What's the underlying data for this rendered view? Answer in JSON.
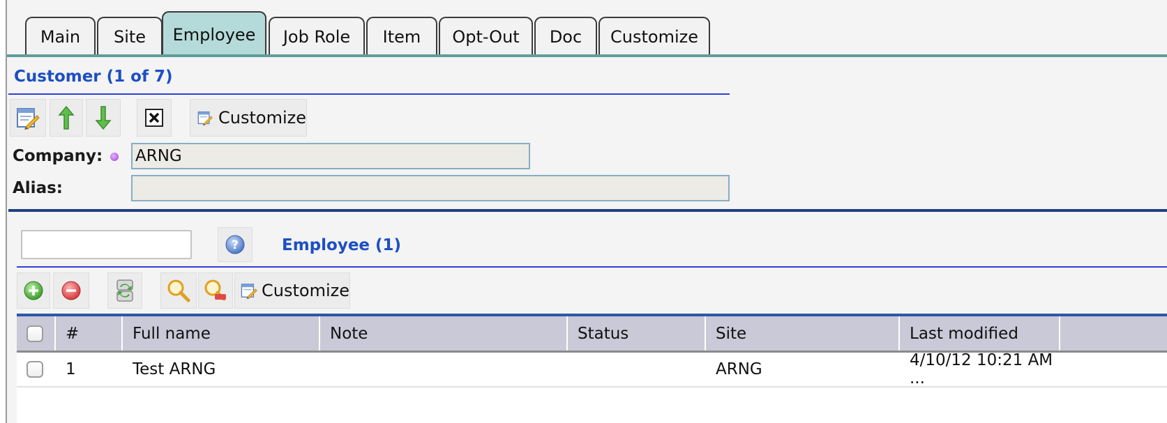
{
  "tabs": [
    {
      "label": "Main"
    },
    {
      "label": "Site"
    },
    {
      "label": "Employee"
    },
    {
      "label": "Job Role"
    },
    {
      "label": "Item"
    },
    {
      "label": "Opt-Out"
    },
    {
      "label": "Doc"
    },
    {
      "label": "Customize"
    }
  ],
  "active_tab": "Employee",
  "customer": {
    "title": "Customer (1 of 7)",
    "toolbar": {
      "icons": [
        "edit-icon",
        "arrow-up-icon",
        "arrow-down-icon",
        "close-box-icon",
        "customize-icon"
      ],
      "customize_label": "Customize"
    },
    "company_label": "Company:",
    "company_value": "ARNG",
    "alias_label": "Alias:",
    "alias_value": ""
  },
  "employee": {
    "search_value": "",
    "title": "Employee (1)",
    "toolbar": {
      "icons": [
        "add-icon",
        "remove-icon",
        "refresh-icon",
        "search-icon",
        "clear-search-icon",
        "customize-icon"
      ],
      "customize_label": "Customize"
    },
    "columns": [
      "#",
      "Full name",
      "Note",
      "Status",
      "Site",
      "Last modified"
    ],
    "rows": [
      {
        "num": "1",
        "full_name": "Test ARNG",
        "note": "",
        "status": "",
        "site": "ARNG",
        "last_modified": "4/10/12 10:21 AM ..."
      }
    ]
  },
  "colors": {
    "tab_active": "#b4dbd9",
    "tab_line": "#5e9e9c",
    "title_blue": "#1c4fc4",
    "grid_header": "#c9c9d8"
  }
}
